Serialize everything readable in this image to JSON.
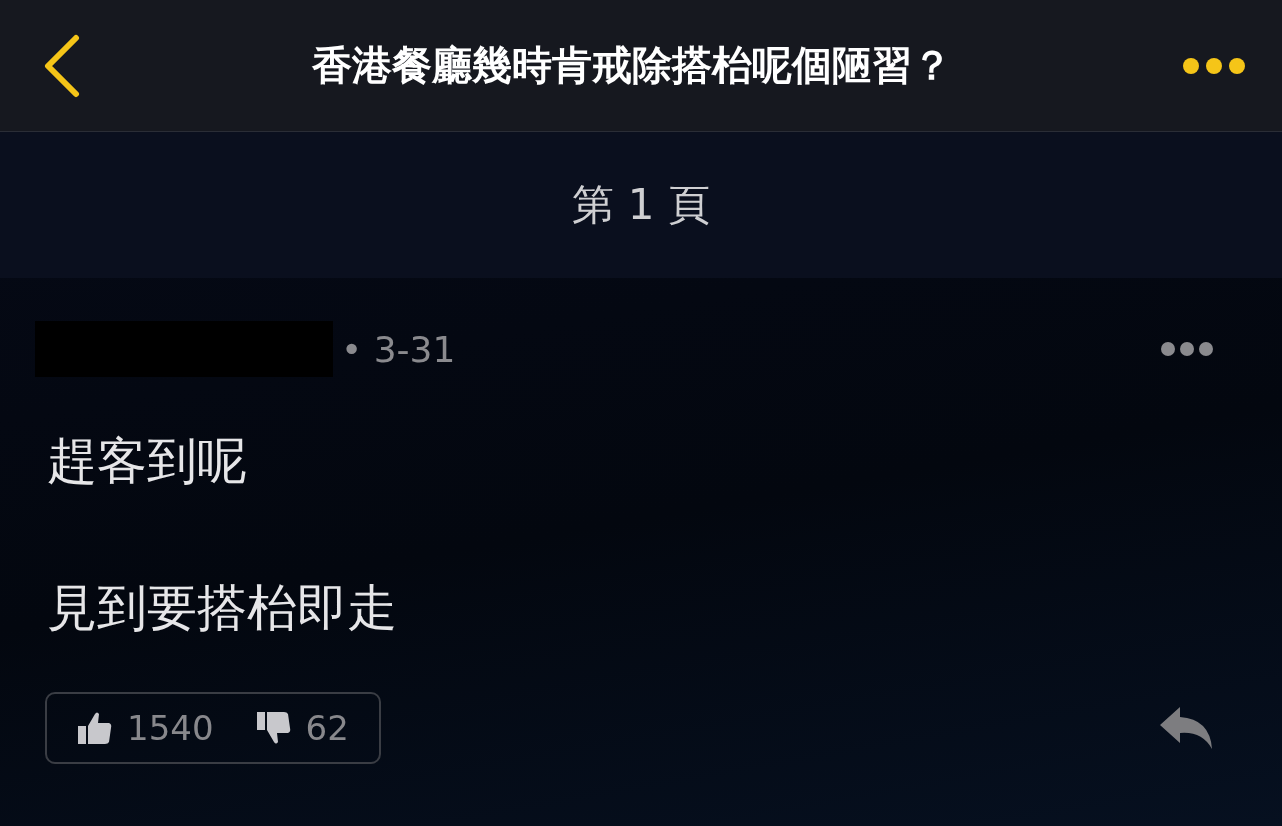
{
  "header": {
    "title": "香港餐廳幾時肯戒除搭枱呢個陋習？"
  },
  "page_label": "第 1 頁",
  "post": {
    "date": "• 3-31",
    "paragraphs": [
      "趕客到呢",
      "見到要搭枱即走"
    ],
    "likes": "1540",
    "dislikes": "62"
  }
}
